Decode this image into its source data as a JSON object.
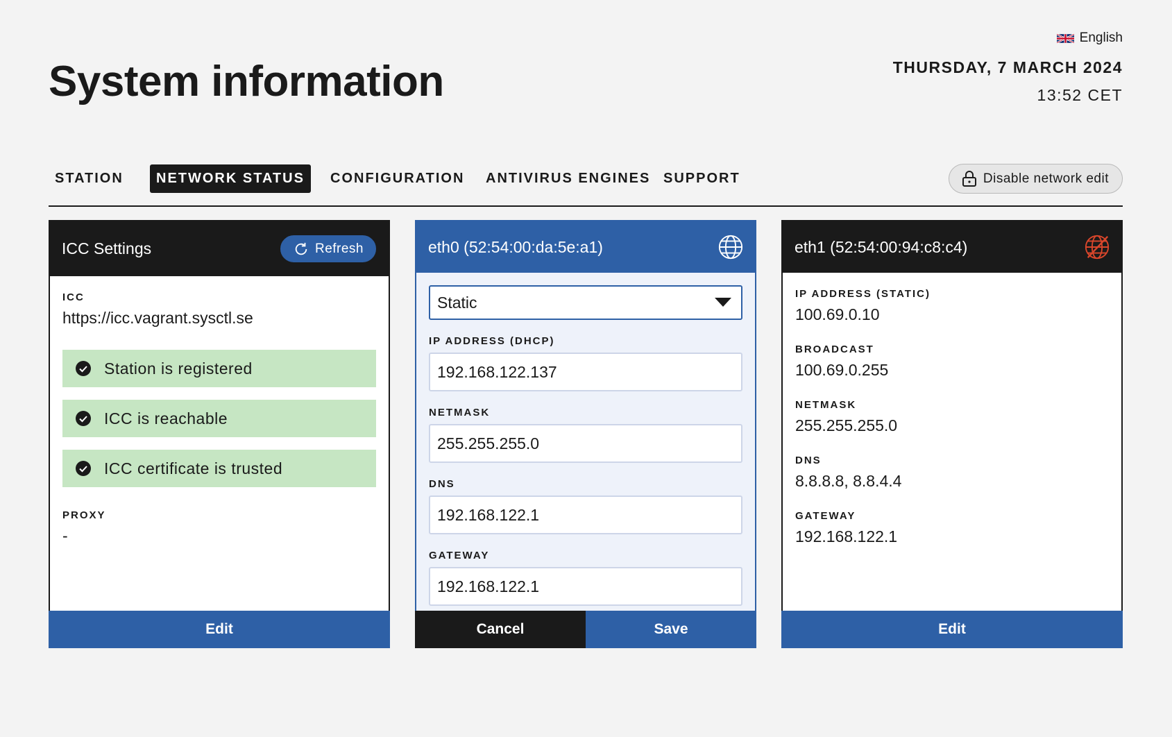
{
  "header": {
    "title": "System information",
    "language": "English",
    "date": "THURSDAY, 7 MARCH 2024",
    "time": "13:52 CET"
  },
  "tabs": [
    {
      "label": "STATION",
      "active": false
    },
    {
      "label": "NETWORK STATUS",
      "active": true
    },
    {
      "label": "CONFIGURATION",
      "active": false
    },
    {
      "label": "ANTIVIRUS ENGINES",
      "active": false
    },
    {
      "label": "SUPPORT",
      "active": false
    }
  ],
  "lock_button": {
    "label": "Disable network edit",
    "icon": "lock-open-icon"
  },
  "icc": {
    "title": "ICC Settings",
    "refresh_label": "Refresh",
    "icc_label": "ICC",
    "icc_value": "https://icc.vagrant.sysctl.se",
    "statuses": [
      "Station is registered",
      "ICC is reachable",
      "ICC certificate is trusted"
    ],
    "proxy_label": "PROXY",
    "proxy_value": "-",
    "edit_label": "Edit"
  },
  "eth0": {
    "title": "eth0 (52:54:00:da:5e:a1)",
    "icon": "globe-icon",
    "mode": "Static",
    "ip_label": "IP ADDRESS (DHCP)",
    "ip_value": "192.168.122.137",
    "netmask_label": "NETMASK",
    "netmask_value": "255.255.255.0",
    "dns_label": "DNS",
    "dns_value": "192.168.122.1",
    "gateway_label": "GATEWAY",
    "gateway_value": "192.168.122.1",
    "cancel_label": "Cancel",
    "save_label": "Save"
  },
  "eth1": {
    "title": "eth1 (52:54:00:94:c8:c4)",
    "icon": "globe-disconnected-icon",
    "ip_label": "IP ADDRESS (STATIC)",
    "ip_value": "100.69.0.10",
    "broadcast_label": "BROADCAST",
    "broadcast_value": "100.69.0.255",
    "netmask_label": "NETMASK",
    "netmask_value": "255.255.255.0",
    "dns_label": "DNS",
    "dns_value": "8.8.8.8, 8.8.4.4",
    "gateway_label": "GATEWAY",
    "gateway_value": "192.168.122.1",
    "edit_label": "Edit"
  },
  "colors": {
    "accent": "#2e60a6",
    "dark": "#1a1a1a",
    "success": "#c6e6c3",
    "error": "#d9462b",
    "background": "#f3f3f3"
  }
}
